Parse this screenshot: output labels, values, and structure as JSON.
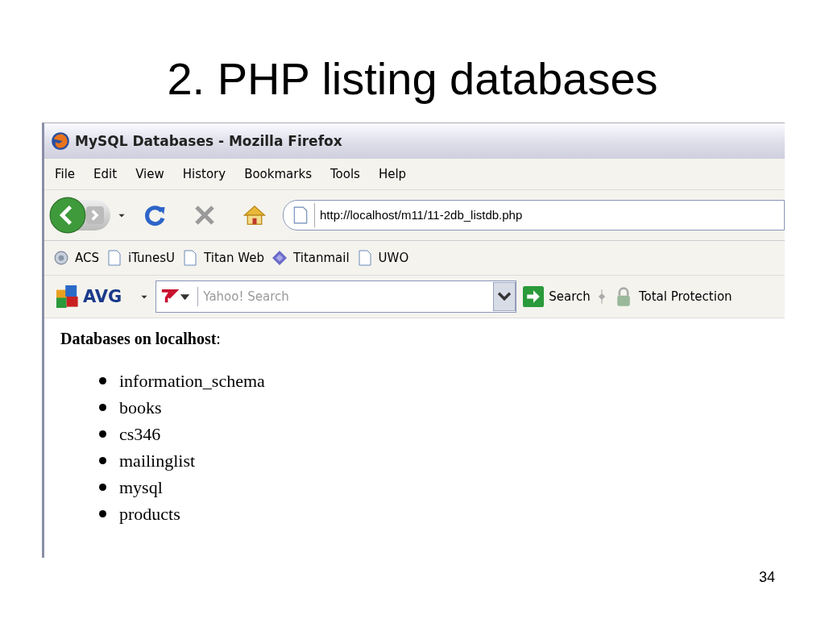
{
  "slide": {
    "title": "2. PHP listing databases",
    "page_number": "34"
  },
  "window": {
    "title": "MySQL Databases - Mozilla Firefox"
  },
  "menu": [
    "File",
    "Edit",
    "View",
    "History",
    "Bookmarks",
    "Tools",
    "Help"
  ],
  "address_bar": {
    "value": "http://localhost/m11/11-2db_listdb.php"
  },
  "bookmarks": [
    {
      "label": "ACS",
      "kind": "globe"
    },
    {
      "label": "iTunesU",
      "kind": "page"
    },
    {
      "label": "Titan Web",
      "kind": "page"
    },
    {
      "label": "Titanmail",
      "kind": "diamond"
    },
    {
      "label": "UWO",
      "kind": "page"
    }
  ],
  "avg_toolbar": {
    "logo": "AVG",
    "search": {
      "placeholder": "Yahoo! Search"
    },
    "search_button": "Search",
    "protection": "Total Protection"
  },
  "page": {
    "heading": "**Databases on localhost**:",
    "databases": [
      "information_schema",
      "books",
      "cs346",
      "mailinglist",
      "mysql",
      "products"
    ]
  }
}
